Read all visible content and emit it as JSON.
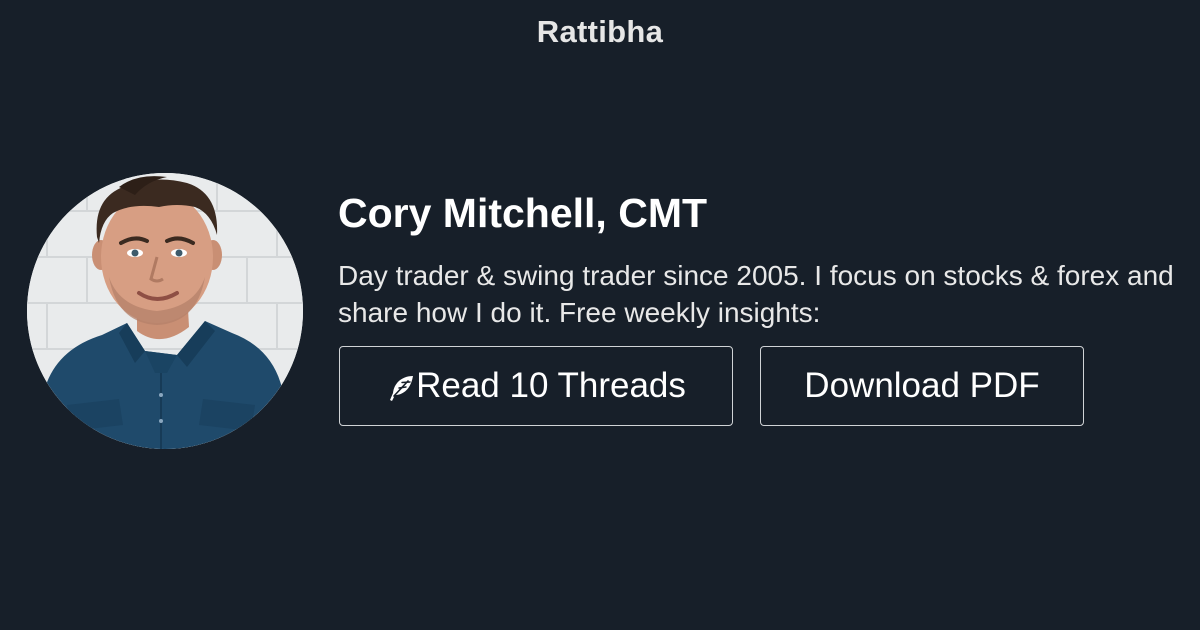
{
  "site": {
    "brand": "Rattibha"
  },
  "profile": {
    "name": "Cory Mitchell, CMT",
    "bio": "Day trader & swing trader since 2005. I focus on stocks & forex and share how I do it. Free weekly insights:",
    "avatar_icon": "profile-photo"
  },
  "actions": {
    "read_label": "Read 10 Threads",
    "read_icon": "feather-icon",
    "download_label": "Download PDF"
  },
  "colors": {
    "background": "#171f29",
    "text": "#ffffff",
    "button_border": "#d0d3d6"
  }
}
